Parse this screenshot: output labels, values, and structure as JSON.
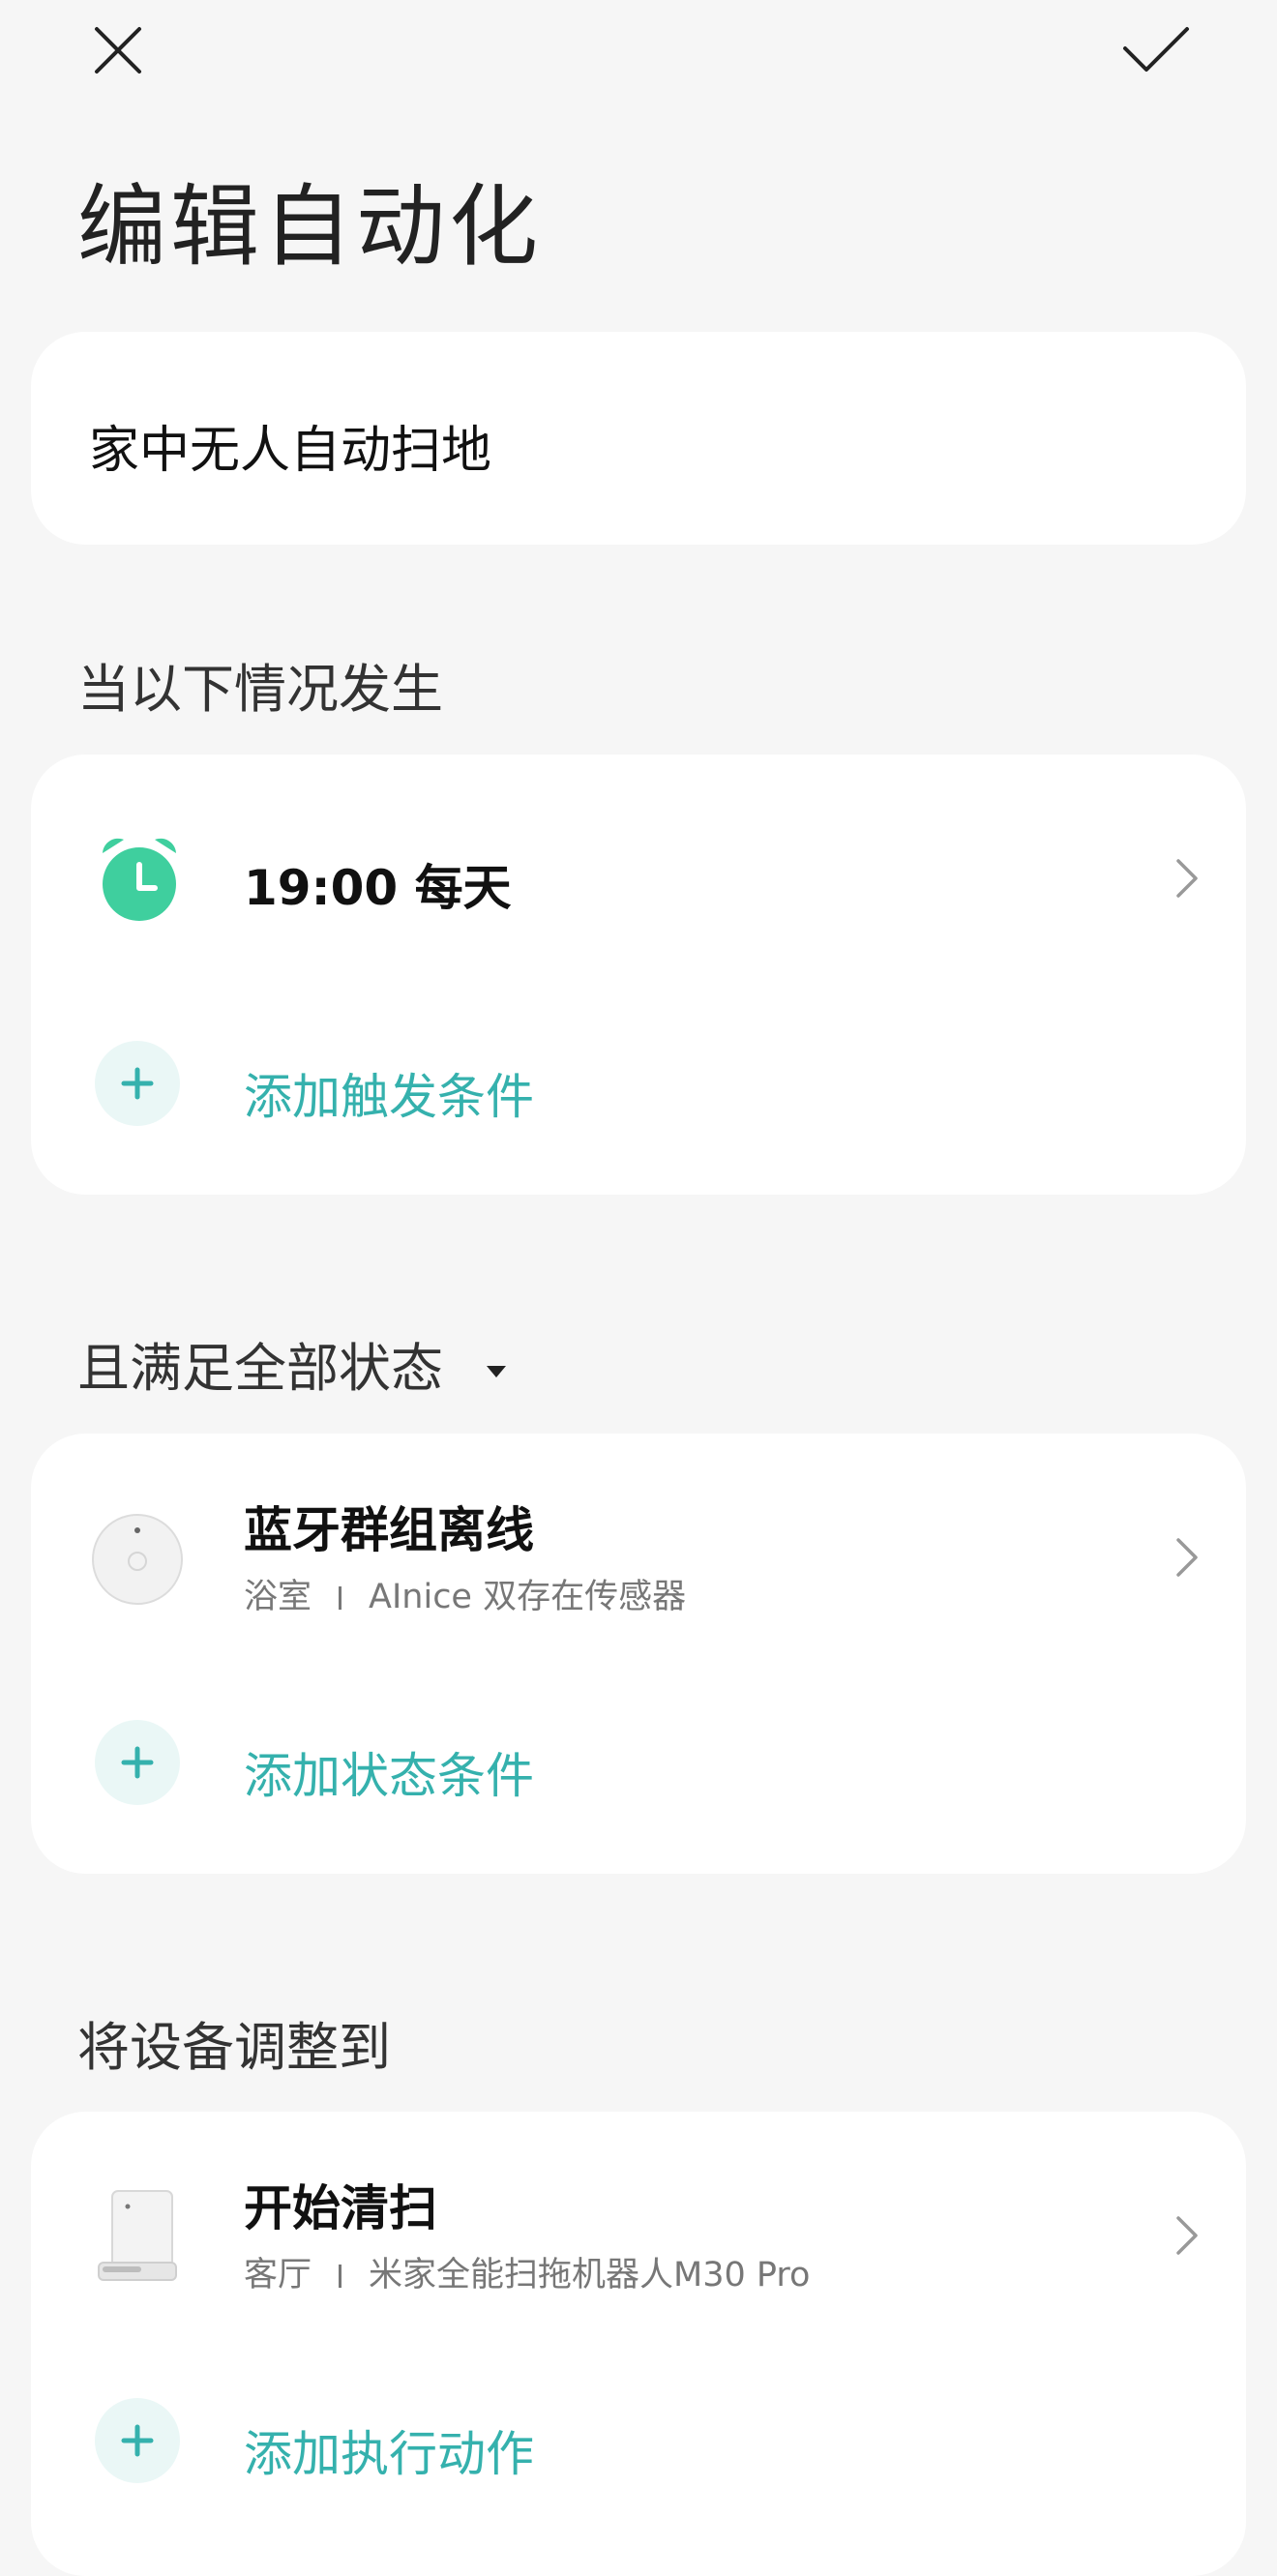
{
  "header": {
    "close_icon": "close-icon",
    "confirm_icon": "checkmark-icon",
    "title": "编辑自动化"
  },
  "name_card": {
    "value": "家中无人自动扫地"
  },
  "trigger_section": {
    "label": "当以下情况发生",
    "items": [
      {
        "icon": "alarm-clock-icon",
        "title": "19:00 每天"
      }
    ],
    "add_label": "添加触发条件"
  },
  "condition_section": {
    "label": "且满足全部状态",
    "dropdown_icon": "caret-down-icon",
    "items": [
      {
        "icon": "sensor-device-icon",
        "title": "蓝牙群组离线",
        "room": "浴室",
        "device": "AInice 双存在传感器"
      }
    ],
    "add_label": "添加状态条件"
  },
  "action_section": {
    "label": "将设备调整到",
    "items": [
      {
        "icon": "robot-vacuum-icon",
        "title": "开始清扫",
        "room": "客厅",
        "device": "米家全能扫拖机器人M30 Pro"
      }
    ],
    "add_label": "添加执行动作"
  },
  "colors": {
    "accent": "#35b1ad",
    "alarm": "#3fcf9e",
    "background": "#f6f6f6"
  }
}
